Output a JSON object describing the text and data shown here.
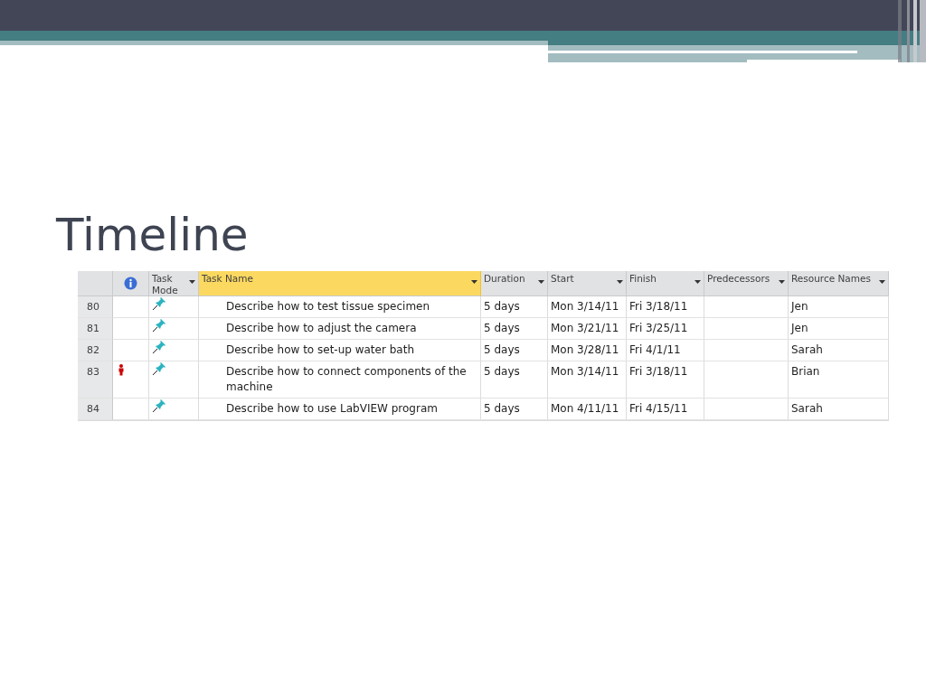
{
  "slide": {
    "title": "Timeline"
  },
  "table": {
    "columns": [
      {
        "kind": "id",
        "selected": false
      },
      {
        "kind": "info",
        "selected": false
      },
      {
        "kind": "text",
        "label": "Task Mode",
        "filter": true,
        "selected": false
      },
      {
        "kind": "text",
        "label": "Task Name",
        "filter": true,
        "selected": true
      },
      {
        "kind": "text",
        "label": "Duration",
        "filter": true,
        "selected": false
      },
      {
        "kind": "text",
        "label": "Start",
        "filter": true,
        "selected": false
      },
      {
        "kind": "text",
        "label": "Finish",
        "filter": true,
        "selected": false
      },
      {
        "kind": "text",
        "label": "Predecessors",
        "filter": true,
        "selected": false
      },
      {
        "kind": "text",
        "label": "Resource Names",
        "filter": true,
        "selected": false
      }
    ],
    "rows": [
      {
        "id": "80",
        "resource_indicator": false,
        "name": "Describe how to test tissue specimen",
        "duration": "5 days",
        "start": "Mon 3/14/11",
        "finish": "Fri 3/18/11",
        "resource": "Jen"
      },
      {
        "id": "81",
        "resource_indicator": false,
        "name": "Describe how to adjust the camera",
        "duration": "5 days",
        "start": "Mon 3/21/11",
        "finish": "Fri 3/25/11",
        "resource": "Jen"
      },
      {
        "id": "82",
        "resource_indicator": false,
        "name": "Describe how to set-up water bath",
        "duration": "5 days",
        "start": "Mon 3/28/11",
        "finish": "Fri 4/1/11",
        "resource": "Sarah"
      },
      {
        "id": "83",
        "resource_indicator": true,
        "name": "Describe how to connect components of the machine",
        "duration": "5 days",
        "start": "Mon 3/14/11",
        "finish": "Fri 3/18/11",
        "resource": "Brian"
      },
      {
        "id": "84",
        "resource_indicator": false,
        "name": "Describe how to use LabVIEW program",
        "duration": "5 days",
        "start": "Mon 4/11/11",
        "finish": "Fri 4/15/11",
        "resource": "Sarah"
      }
    ]
  }
}
